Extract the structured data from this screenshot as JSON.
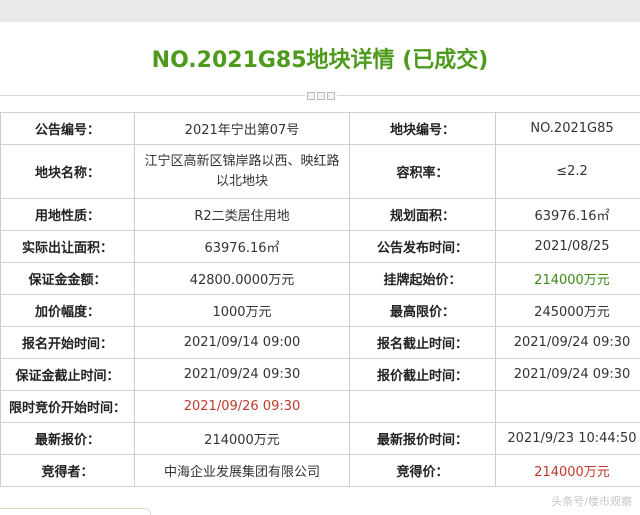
{
  "header": {
    "title": "NO.2021G85地块详情 (已成交)"
  },
  "rows": [
    {
      "l1": "公告编号：",
      "v1": "2021年宁出第07号",
      "l2": "地块编号：",
      "v2": "NO.2021G85"
    },
    {
      "l1": "地块名称：",
      "v1": "江宁区高新区锦岸路以西、映红路以北地块",
      "l2": "容积率：",
      "v2": "≤2.2"
    },
    {
      "l1": "用地性质：",
      "v1": "R2二类居住用地",
      "l2": "规划面积：",
      "v2": "63976.16㎡"
    },
    {
      "l1": "实际出让面积：",
      "v1": "63976.16㎡",
      "l2": "公告发布时间：",
      "v2": "2021/08/25"
    },
    {
      "l1": "保证金金额：",
      "v1": "42800.0000万元",
      "l2": "挂牌起始价：",
      "v2": "214000万元"
    },
    {
      "l1": "加价幅度：",
      "v1": "1000万元",
      "l2": "最高限价：",
      "v2": "245000万元"
    },
    {
      "l1": "报名开始时间：",
      "v1": "2021/09/14 09:00",
      "l2": "报名截止时间：",
      "v2": "2021/09/24 09:30"
    },
    {
      "l1": "保证金截止时间：",
      "v1": "2021/09/24 09:30",
      "l2": "报价截止时间：",
      "v2": "2021/09/24 09:30"
    },
    {
      "l1": "限时竞价开始时间：",
      "v1": "2021/09/26 09:30",
      "l2": "",
      "v2": ""
    },
    {
      "l1": "最新报价：",
      "v1": "214000万元",
      "l2": "最新报价时间：",
      "v2": "2021/9/23 10:44:50"
    },
    {
      "l1": "竞得者：",
      "v1": "中海企业发展集团有限公司",
      "l2": "竞得价：",
      "v2": "214000万元"
    }
  ],
  "watermark": "头条号/楼市观察"
}
